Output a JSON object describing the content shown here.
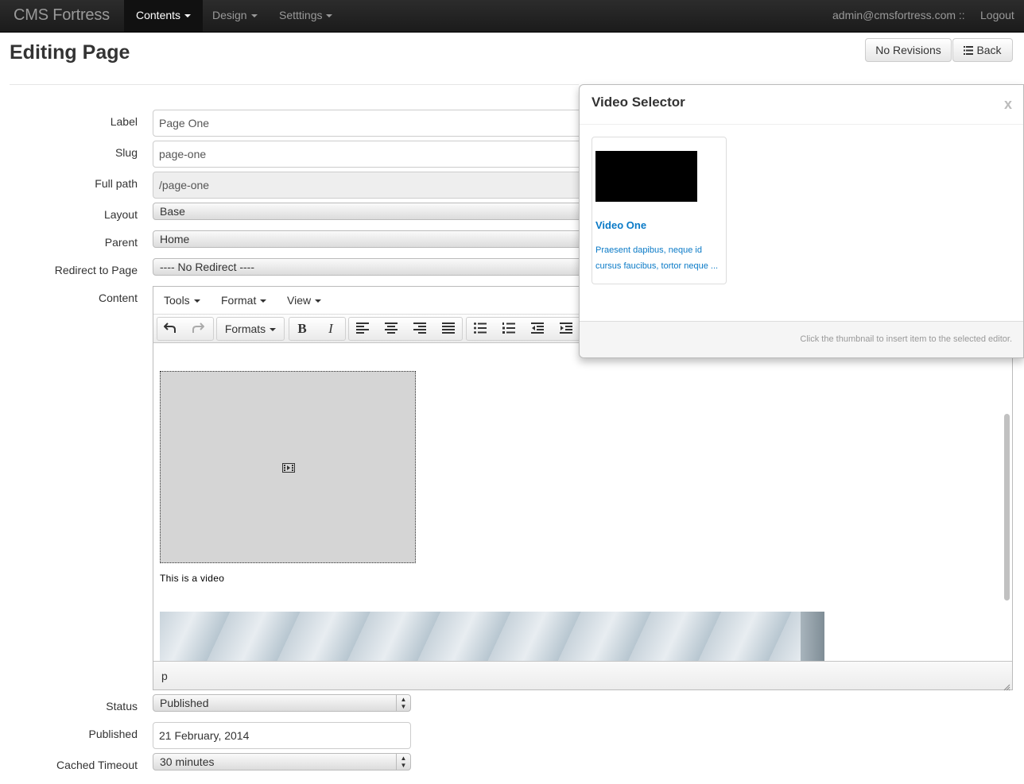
{
  "navbar": {
    "brand": "CMS Fortress",
    "items": [
      {
        "label": "Contents",
        "active": true
      },
      {
        "label": "Design",
        "active": false
      },
      {
        "label": "Setttings",
        "active": false
      }
    ],
    "user": "admin@cmsfortress.com ::",
    "logout": "Logout"
  },
  "header": {
    "title": "Editing Page",
    "revisions_button": "No Revisions",
    "back_button": "Back"
  },
  "form": {
    "label": {
      "label": "Label",
      "value": "Page One"
    },
    "slug": {
      "label": "Slug",
      "value": "page-one"
    },
    "full_path": {
      "label": "Full path",
      "value": "/page-one"
    },
    "layout": {
      "label": "Layout",
      "value": "Base"
    },
    "parent": {
      "label": "Parent",
      "value": "Home"
    },
    "redirect": {
      "label": "Redirect to Page",
      "value": "---- No Redirect ----"
    },
    "content": {
      "label": "Content"
    },
    "status": {
      "label": "Status",
      "value": "Published"
    },
    "published": {
      "label": "Published",
      "value": "21 February, 2014"
    },
    "cached_timeout": {
      "label": "Cached Timeout",
      "value": "30 minutes"
    }
  },
  "editor": {
    "menus": [
      "Tools",
      "Format",
      "View"
    ],
    "formats_label": "Formats",
    "caption": "This is a video",
    "path": "p",
    "toolbar_icons": [
      "undo-icon",
      "redo-icon",
      "bold-icon",
      "italic-icon",
      "align-left-icon",
      "align-center-icon",
      "align-right-icon",
      "align-justify-icon",
      "bullet-list-icon",
      "numbered-list-icon",
      "outdent-icon",
      "indent-icon"
    ]
  },
  "video_selector": {
    "title": "Video Selector",
    "close": "x",
    "items": [
      {
        "title": "Video One",
        "description": "Praesent dapibus, neque id cursus faucibus, tortor neque ..."
      }
    ],
    "hint": "Click the thumbnail to insert item to the selected editor."
  },
  "colors": {
    "navbar": "#1b1b1b",
    "link": "#0a7ac7",
    "video_placeholder": "#d5d5d5"
  }
}
